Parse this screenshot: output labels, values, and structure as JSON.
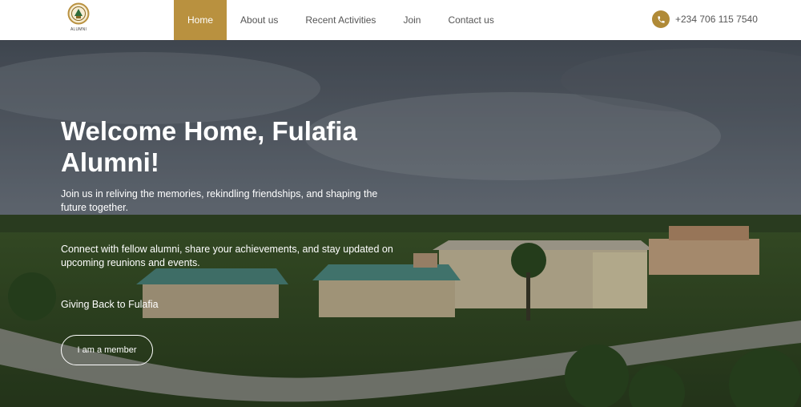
{
  "logo": {
    "text": "ALUMNI"
  },
  "nav": {
    "items": [
      {
        "label": "Home",
        "active": true
      },
      {
        "label": "About us",
        "active": false
      },
      {
        "label": "Recent Activities",
        "active": false
      },
      {
        "label": "Join",
        "active": false
      },
      {
        "label": "Contact us",
        "active": false
      }
    ]
  },
  "contact": {
    "phone": "+234 706 115 7540",
    "icon": "phone-icon"
  },
  "hero": {
    "title": "Welcome Home, Fulafia Alumni!",
    "paragraph1": "Join us in reliving the memories, rekindling friendships, and shaping the future together.",
    "paragraph2": "Connect with fellow alumni, share your achievements, and stay updated on upcoming reunions and events.",
    "paragraph3": "Giving Back to Fulafia",
    "button_label": "I am a member"
  },
  "colors": {
    "accent": "#b9913f",
    "nav_text": "#555555",
    "hero_text": "#ffffff"
  }
}
